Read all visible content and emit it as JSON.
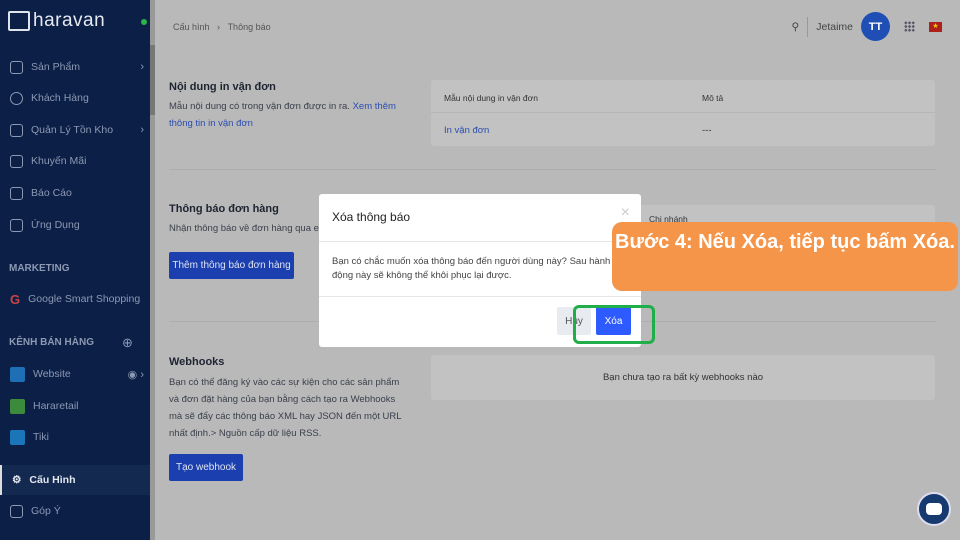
{
  "sidebar": {
    "brand": "haravan",
    "items": [
      {
        "label": "Sản Phẩm"
      },
      {
        "label": "Khách Hàng"
      },
      {
        "label": "Quản Lý Tồn Kho"
      },
      {
        "label": "Khuyến Mãi"
      },
      {
        "label": "Báo Cáo"
      },
      {
        "label": "Ứng Dụng"
      }
    ],
    "marketing_title": "MARKETING",
    "marketing_items": [
      {
        "label": "Google Smart Shopping"
      }
    ],
    "channels_title": "KÊNH BÁN HÀNG",
    "channels": [
      {
        "label": "Website"
      },
      {
        "label": "Hararetail"
      },
      {
        "label": "Tiki"
      }
    ],
    "settings": "Cấu Hình",
    "feedback": "Góp Ý"
  },
  "header": {
    "breadcrumb": [
      "Cấu hình",
      "›",
      "Thông báo"
    ],
    "user": "Jetaime",
    "avatar": "TT"
  },
  "sections": {
    "print": {
      "title": "Nội dung in vận đơn",
      "desc": "Mẫu nội dung có trong vận đơn được in ra.",
      "link": "Xem thêm thông tin in vận đơn",
      "col1": "Mẫu nội dung in vận đơn",
      "col2": "Mô tả",
      "row_name": "In vận đơn",
      "row_desc": "---"
    },
    "order": {
      "title": "Thông báo đơn hàng",
      "desc": "Nhận thông báo về đơn hàng qua ema",
      "button": "Thêm thông báo đơn hàng",
      "col1": "Chi nhánh"
    },
    "webhooks": {
      "title": "Webhooks",
      "desc": "Bạn có thể đăng ký vào các sự kiện cho các sản phẩm và đơn đặt hàng của bạn bằng cách tạo ra Webhooks mà sẽ đẩy các thông báo XML hay JSON đến một URL nhất định.> Nguồn cấp dữ liệu RSS.",
      "button": "Tạo webhook",
      "empty": "Bạn chưa tạo ra bất kỳ webhooks nào"
    }
  },
  "modal": {
    "title": "Xóa thông báo",
    "close": "×",
    "body": "Bạn có chắc muốn xóa thông báo đến người dùng này? Sau hành động này sẽ không thể khôi phục lại được.",
    "cancel": "Hủy",
    "confirm": "Xóa"
  },
  "callout": {
    "text": "Bước 4: Nếu Xóa, tiếp tục bấm Xóa.",
    "color": "#f5954a"
  }
}
